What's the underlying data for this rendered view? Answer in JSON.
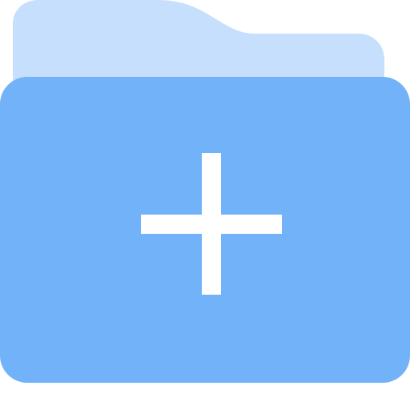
{
  "icon": {
    "name": "folder-add-icon",
    "colors": {
      "folder_back": "#C5DFFC",
      "folder_front": "#72B2F9",
      "plus": "#FFFFFF",
      "background": "#FFFFFF"
    }
  }
}
